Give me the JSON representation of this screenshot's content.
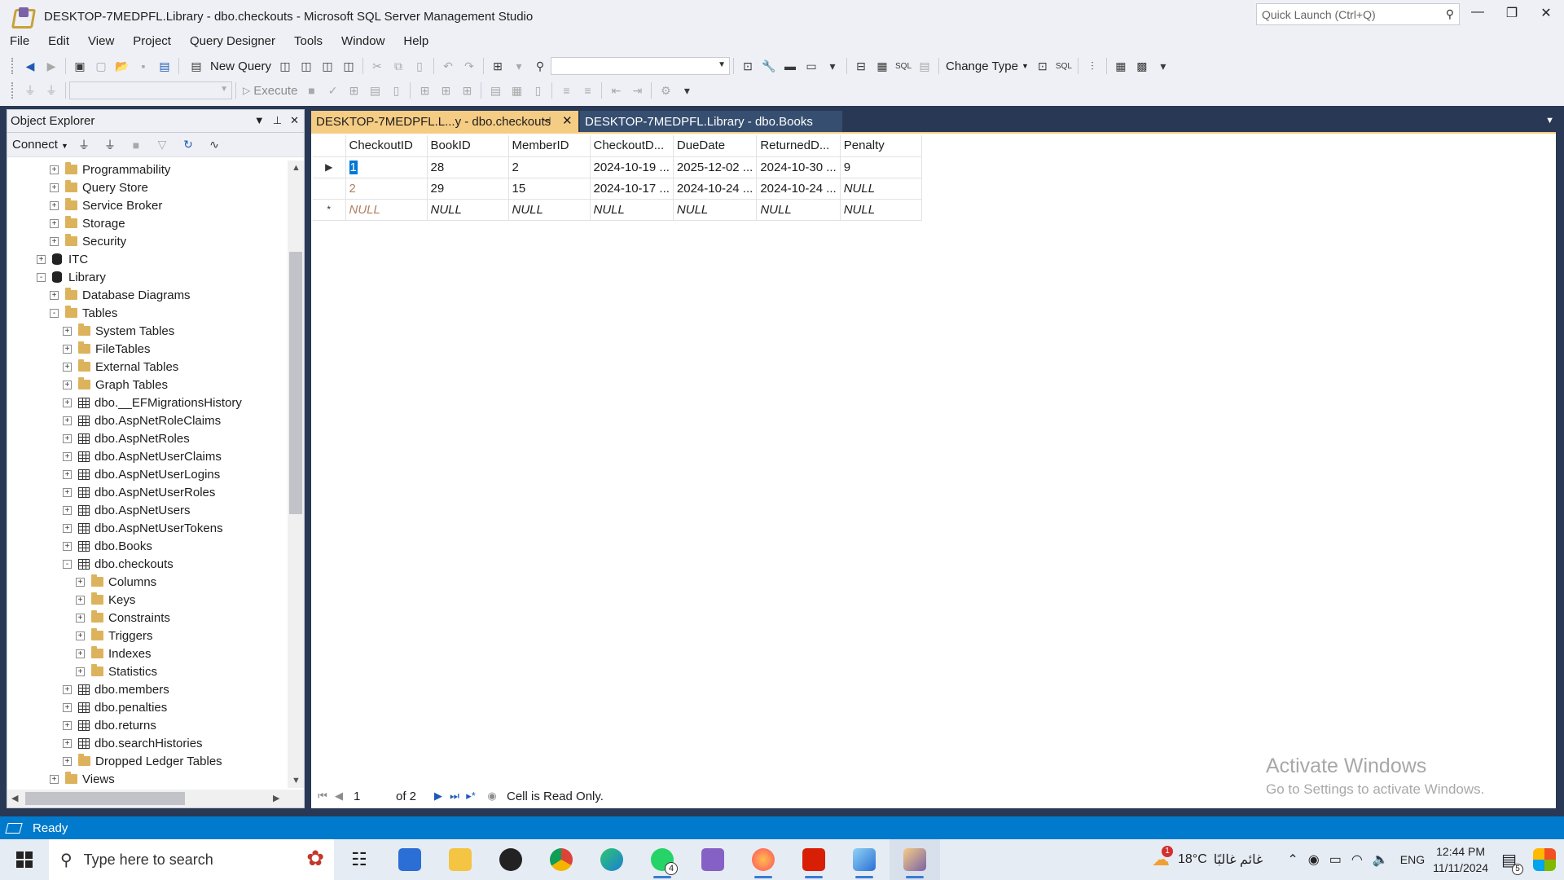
{
  "window": {
    "title": "DESKTOP-7MEDPFL.Library - dbo.checkouts - Microsoft SQL Server Management Studio",
    "quick_launch_placeholder": "Quick Launch (Ctrl+Q)"
  },
  "menu": [
    "File",
    "Edit",
    "View",
    "Project",
    "Query Designer",
    "Tools",
    "Window",
    "Help"
  ],
  "toolbar": {
    "new_query": "New Query",
    "execute": "Execute",
    "change_type": "Change Type",
    "sql_label": "SQL"
  },
  "object_explorer": {
    "title": "Object Explorer",
    "connect": "Connect",
    "tree": [
      {
        "label": "Programmability",
        "indent": 1,
        "icon": "folder-icon",
        "state": "+"
      },
      {
        "label": "Query Store",
        "indent": 1,
        "icon": "folder-icon",
        "state": "+"
      },
      {
        "label": "Service Broker",
        "indent": 1,
        "icon": "folder-icon",
        "state": "+"
      },
      {
        "label": "Storage",
        "indent": 1,
        "icon": "folder-icon",
        "state": "+"
      },
      {
        "label": "Security",
        "indent": 1,
        "icon": "folder-icon",
        "state": "+"
      },
      {
        "label": "ITC",
        "indent": 0,
        "icon": "database-icon",
        "state": "+"
      },
      {
        "label": "Library",
        "indent": 0,
        "icon": "database-icon",
        "state": "-"
      },
      {
        "label": "Database Diagrams",
        "indent": 1,
        "icon": "folder-icon",
        "state": "+"
      },
      {
        "label": "Tables",
        "indent": 1,
        "icon": "folder-icon",
        "state": "-"
      },
      {
        "label": "System Tables",
        "indent": 2,
        "icon": "folder-icon",
        "state": "+"
      },
      {
        "label": "FileTables",
        "indent": 2,
        "icon": "folder-icon",
        "state": "+"
      },
      {
        "label": "External Tables",
        "indent": 2,
        "icon": "folder-icon",
        "state": "+"
      },
      {
        "label": "Graph Tables",
        "indent": 2,
        "icon": "folder-icon",
        "state": "+"
      },
      {
        "label": "dbo.__EFMigrationsHistory",
        "indent": 2,
        "icon": "table-icon",
        "state": "+"
      },
      {
        "label": "dbo.AspNetRoleClaims",
        "indent": 2,
        "icon": "table-icon",
        "state": "+"
      },
      {
        "label": "dbo.AspNetRoles",
        "indent": 2,
        "icon": "table-icon",
        "state": "+"
      },
      {
        "label": "dbo.AspNetUserClaims",
        "indent": 2,
        "icon": "table-icon",
        "state": "+"
      },
      {
        "label": "dbo.AspNetUserLogins",
        "indent": 2,
        "icon": "table-icon",
        "state": "+"
      },
      {
        "label": "dbo.AspNetUserRoles",
        "indent": 2,
        "icon": "table-icon",
        "state": "+"
      },
      {
        "label": "dbo.AspNetUsers",
        "indent": 2,
        "icon": "table-icon",
        "state": "+"
      },
      {
        "label": "dbo.AspNetUserTokens",
        "indent": 2,
        "icon": "table-icon",
        "state": "+"
      },
      {
        "label": "dbo.Books",
        "indent": 2,
        "icon": "table-icon",
        "state": "+"
      },
      {
        "label": "dbo.checkouts",
        "indent": 2,
        "icon": "table-icon",
        "state": "-"
      },
      {
        "label": "Columns",
        "indent": 3,
        "icon": "folder-icon",
        "state": "+"
      },
      {
        "label": "Keys",
        "indent": 3,
        "icon": "folder-icon",
        "state": "+"
      },
      {
        "label": "Constraints",
        "indent": 3,
        "icon": "folder-icon",
        "state": "+"
      },
      {
        "label": "Triggers",
        "indent": 3,
        "icon": "folder-icon",
        "state": "+"
      },
      {
        "label": "Indexes",
        "indent": 3,
        "icon": "folder-icon",
        "state": "+"
      },
      {
        "label": "Statistics",
        "indent": 3,
        "icon": "folder-icon",
        "state": "+"
      },
      {
        "label": "dbo.members",
        "indent": 2,
        "icon": "table-icon",
        "state": "+"
      },
      {
        "label": "dbo.penalties",
        "indent": 2,
        "icon": "table-icon",
        "state": "+"
      },
      {
        "label": "dbo.returns",
        "indent": 2,
        "icon": "table-icon",
        "state": "+"
      },
      {
        "label": "dbo.searchHistories",
        "indent": 2,
        "icon": "table-icon",
        "state": "+"
      },
      {
        "label": "Dropped Ledger Tables",
        "indent": 2,
        "icon": "folder-icon",
        "state": "+"
      },
      {
        "label": "Views",
        "indent": 1,
        "icon": "folder-icon",
        "state": "+"
      }
    ]
  },
  "tabs": {
    "active": "DESKTOP-7MEDPFL.L...y - dbo.checkouts",
    "inactive": "DESKTOP-7MEDPFL.Library - dbo.Books"
  },
  "grid": {
    "columns": [
      "CheckoutID",
      "BookID",
      "MemberID",
      "CheckoutD...",
      "DueDate",
      "ReturnedD...",
      "Penalty"
    ],
    "rows": [
      [
        "1",
        "28",
        "2",
        "2024-10-19 ...",
        "2025-12-02 ...",
        "2024-10-30 ...",
        "9"
      ],
      [
        "2",
        "29",
        "15",
        "2024-10-17 ...",
        "2024-10-24 ...",
        "2024-10-24 ...",
        "NULL"
      ],
      [
        "NULL",
        "NULL",
        "NULL",
        "NULL",
        "NULL",
        "NULL",
        "NULL"
      ]
    ],
    "row_markers": [
      "▶",
      "",
      "*"
    ]
  },
  "navigator": {
    "current": "1",
    "of": "of 2",
    "status": "Cell is Read Only."
  },
  "watermark": {
    "line1": "Activate Windows",
    "line2": "Go to Settings to activate Windows."
  },
  "statusbar": {
    "text": "Ready"
  },
  "taskbar": {
    "search_placeholder": "Type here to search",
    "weather": "18°C",
    "weather_desc": "غائم غالبًا",
    "weather_badge": "1",
    "language": "ENG",
    "time": "12:44 PM",
    "date": "11/11/2024",
    "notifications": "5",
    "whatsapp_badge": "4"
  },
  "colors": {
    "accent": "#007acc",
    "tab_active": "#f5cc84",
    "dark_bg": "#293955",
    "selection": "#0078d7"
  }
}
